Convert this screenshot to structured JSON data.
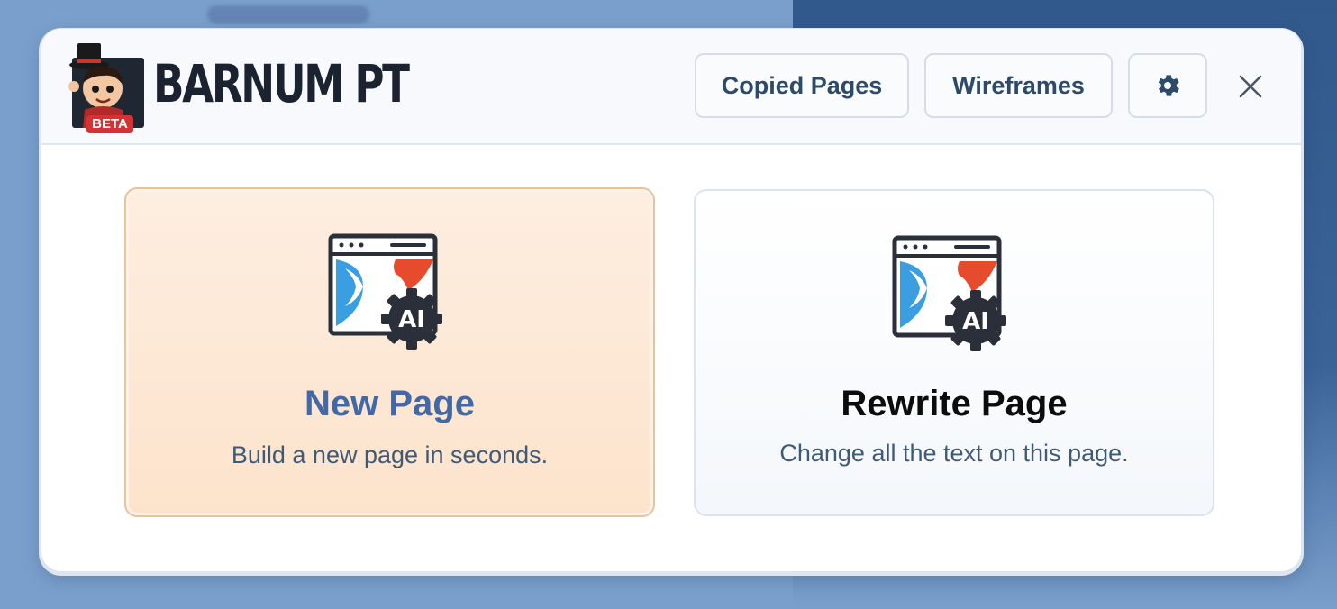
{
  "header": {
    "brand": "BARNUM PT",
    "badge": "BETA",
    "buttons": {
      "copied_pages": "Copied Pages",
      "wireframes": "Wireframes"
    },
    "icons": {
      "settings": "gear-icon",
      "close": "close-icon"
    }
  },
  "cards": [
    {
      "title": "New Page",
      "subtitle": "Build a new page in seconds.",
      "icon": "ai-page-icon",
      "selected": true
    },
    {
      "title": "Rewrite Page",
      "subtitle": "Change all the text on this page.",
      "icon": "ai-page-icon",
      "selected": false
    }
  ],
  "colors": {
    "accent_blue": "#4269a6",
    "selected_card_bg": "#fde8d4",
    "icon_blue": "#3b9ee0",
    "icon_red": "#e64b2e",
    "icon_dark": "#2a2f3a"
  }
}
